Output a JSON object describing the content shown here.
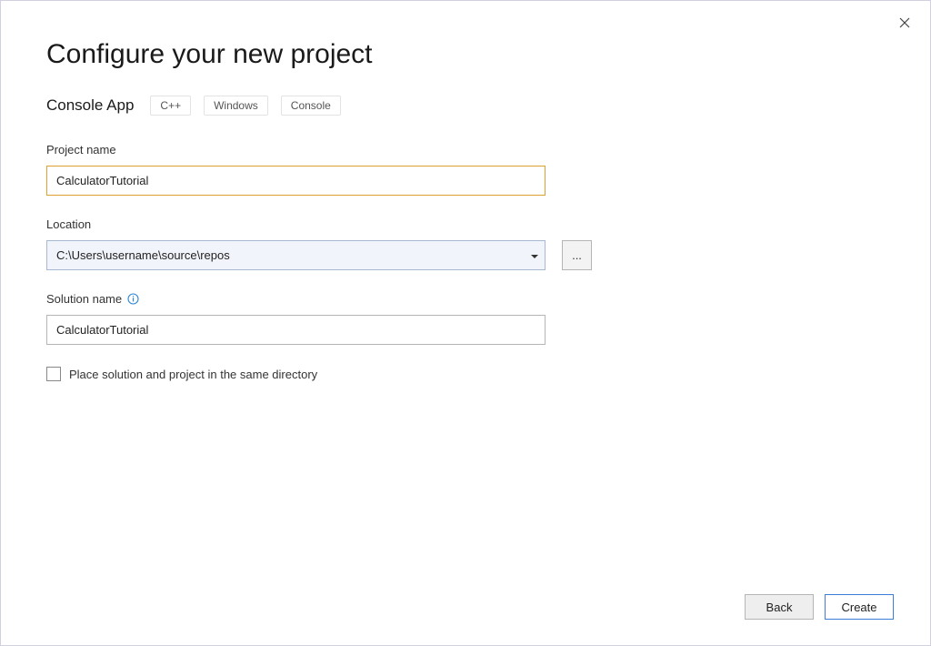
{
  "header": {
    "title": "Configure your new project"
  },
  "template": {
    "name": "Console App",
    "tags": [
      "C++",
      "Windows",
      "Console"
    ]
  },
  "fields": {
    "project_name": {
      "label": "Project name",
      "value": "CalculatorTutorial"
    },
    "location": {
      "label": "Location",
      "value": "C:\\Users\\username\\source\\repos",
      "browse_label": "..."
    },
    "solution_name": {
      "label": "Solution name",
      "value": "CalculatorTutorial"
    },
    "same_directory": {
      "label": "Place solution and project in the same directory",
      "checked": false
    }
  },
  "footer": {
    "back_label": "Back",
    "create_label": "Create"
  }
}
